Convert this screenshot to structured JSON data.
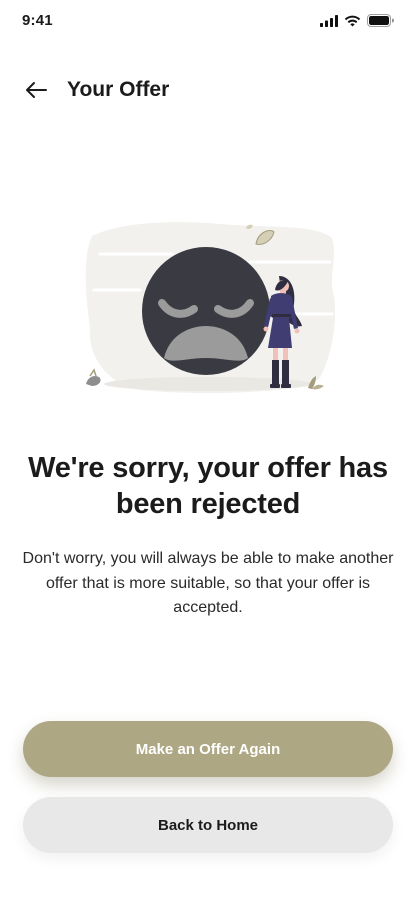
{
  "status_bar": {
    "time": "9:41",
    "signal_icon": "signal-icon",
    "wifi_icon": "wifi-icon",
    "battery_icon": "battery-icon"
  },
  "header": {
    "title": "Your Offer",
    "back_icon": "arrow-left-icon"
  },
  "illustration": {
    "name": "sad-face-illustration"
  },
  "message": {
    "headline": "We're sorry, your offer has been rejected",
    "body": "Don't worry, you will always be able to make another offer that is more suitable, so that your offer is accepted."
  },
  "actions": {
    "primary_label": "Make an Offer Again",
    "secondary_label": "Back to Home"
  },
  "colors": {
    "accent": "#aea784",
    "secondary_button": "#e8e8e8",
    "text": "#1b1b1b",
    "face": "#3a3b42",
    "dress": "#3f3d72"
  }
}
